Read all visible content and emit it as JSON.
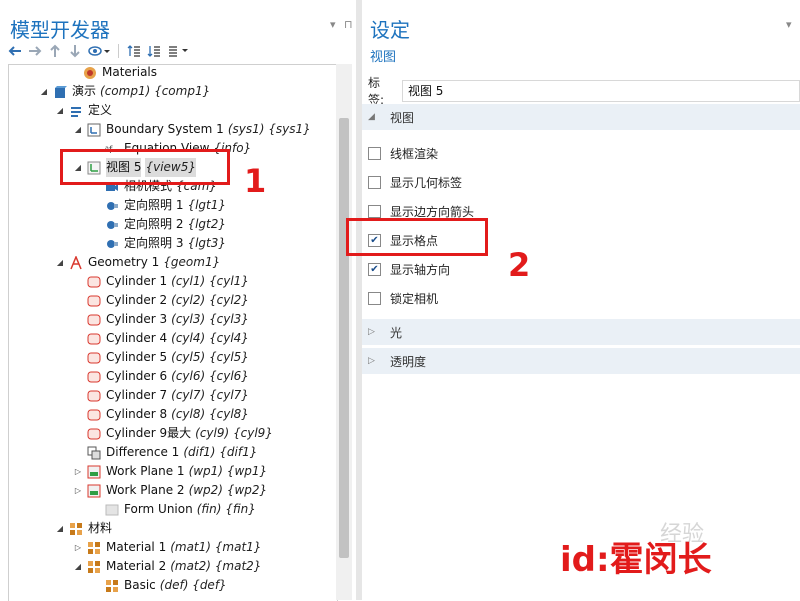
{
  "left_pane": {
    "title": "模型开发器",
    "pin": "▾",
    "pushpin": "⊓"
  },
  "toolbar": {
    "icons": [
      "back-icon",
      "forward-icon",
      "up-icon",
      "down-icon",
      "view-options-icon",
      "expand-all-icon",
      "collapse-all-icon",
      "show-more-icon"
    ]
  },
  "tree": {
    "rows": [
      {
        "indent": 60,
        "arrow": "",
        "icon": "materials",
        "label": "Materials",
        "tag": ""
      },
      {
        "indent": 30,
        "arrow": "◢",
        "icon": "component",
        "label": "演示",
        "tag": "(comp1) {comp1}"
      },
      {
        "indent": 46,
        "arrow": "◢",
        "icon": "definitions",
        "label": "定义",
        "tag": ""
      },
      {
        "indent": 64,
        "arrow": "◢",
        "icon": "coordsys",
        "label": "Boundary System 1",
        "tag": "(sys1) {sys1}"
      },
      {
        "indent": 82,
        "arrow": "",
        "icon": "equation",
        "label": "Equation View",
        "tag": "{info}"
      },
      {
        "indent": 64,
        "arrow": "◢",
        "icon": "view",
        "label": "视图 5",
        "tag": "{view5}",
        "selected": true
      },
      {
        "indent": 82,
        "arrow": "",
        "icon": "camera",
        "label": "相机模式",
        "tag": "{cam}"
      },
      {
        "indent": 82,
        "arrow": "",
        "icon": "light",
        "label": "定向照明 1",
        "tag": "{lgt1}"
      },
      {
        "indent": 82,
        "arrow": "",
        "icon": "light",
        "label": "定向照明 2",
        "tag": "{lgt2}"
      },
      {
        "indent": 82,
        "arrow": "",
        "icon": "light",
        "label": "定向照明 3",
        "tag": "{lgt3}"
      },
      {
        "indent": 46,
        "arrow": "◢",
        "icon": "geometry",
        "label": "Geometry 1",
        "tag": "{geom1}"
      },
      {
        "indent": 64,
        "arrow": "",
        "icon": "cylinder",
        "label": "Cylinder 1",
        "tag": "(cyl1) {cyl1}"
      },
      {
        "indent": 64,
        "arrow": "",
        "icon": "cylinder",
        "label": "Cylinder 2",
        "tag": "(cyl2) {cyl2}"
      },
      {
        "indent": 64,
        "arrow": "",
        "icon": "cylinder",
        "label": "Cylinder 3",
        "tag": "(cyl3) {cyl3}"
      },
      {
        "indent": 64,
        "arrow": "",
        "icon": "cylinder",
        "label": "Cylinder 4",
        "tag": "(cyl4) {cyl4}"
      },
      {
        "indent": 64,
        "arrow": "",
        "icon": "cylinder",
        "label": "Cylinder 5",
        "tag": "(cyl5) {cyl5}"
      },
      {
        "indent": 64,
        "arrow": "",
        "icon": "cylinder",
        "label": "Cylinder 6",
        "tag": "(cyl6) {cyl6}"
      },
      {
        "indent": 64,
        "arrow": "",
        "icon": "cylinder",
        "label": "Cylinder 7",
        "tag": "(cyl7) {cyl7}"
      },
      {
        "indent": 64,
        "arrow": "",
        "icon": "cylinder",
        "label": "Cylinder 8",
        "tag": "(cyl8) {cyl8}"
      },
      {
        "indent": 64,
        "arrow": "",
        "icon": "cylinder",
        "label": "Cylinder 9最大",
        "tag": "(cyl9) {cyl9}"
      },
      {
        "indent": 64,
        "arrow": "",
        "icon": "difference",
        "label": "Difference 1",
        "tag": "(dif1) {dif1}"
      },
      {
        "indent": 64,
        "arrow": "▷",
        "icon": "workplane",
        "label": "Work Plane 1",
        "tag": "(wp1) {wp1}"
      },
      {
        "indent": 64,
        "arrow": "▷",
        "icon": "workplane",
        "label": "Work Plane 2",
        "tag": "(wp2) {wp2}"
      },
      {
        "indent": 82,
        "arrow": "",
        "icon": "formunion",
        "label": "Form Union",
        "tag": "(fin) {fin}"
      },
      {
        "indent": 46,
        "arrow": "◢",
        "icon": "material",
        "label": "材料",
        "tag": ""
      },
      {
        "indent": 64,
        "arrow": "▷",
        "icon": "material",
        "label": "Material 1",
        "tag": "(mat1) {mat1}"
      },
      {
        "indent": 64,
        "arrow": "◢",
        "icon": "material",
        "label": "Material 2",
        "tag": "(mat2) {mat2}"
      },
      {
        "indent": 82,
        "arrow": "",
        "icon": "material",
        "label": "Basic",
        "tag": "(def) {def}"
      }
    ]
  },
  "right_pane": {
    "title": "设定",
    "subtitle": "视图",
    "pin": "▾",
    "label_caption": "标签:",
    "label_value": "视图 5",
    "section_view": {
      "arrow": "◢",
      "title": "视图"
    },
    "options": [
      {
        "label": "线框渲染",
        "checked": false
      },
      {
        "label": "显示几何标签",
        "checked": false
      },
      {
        "label": "显示边方向箭头",
        "checked": false
      },
      {
        "label": "显示格点",
        "checked": true
      },
      {
        "label": "显示轴方向",
        "checked": true
      },
      {
        "label": "锁定相机",
        "checked": false
      }
    ],
    "section_light": {
      "arrow": "▷",
      "title": "光"
    },
    "section_transparency": {
      "arrow": "▷",
      "title": "透明度"
    }
  },
  "annotations": {
    "num1": "1",
    "num2": "2",
    "watermark": "id:霍闵长",
    "watermark_logo": "经验"
  },
  "colors": {
    "accent": "#1e73be",
    "annotation": "#e21b1b",
    "section_bg": "#eaf0f6"
  }
}
